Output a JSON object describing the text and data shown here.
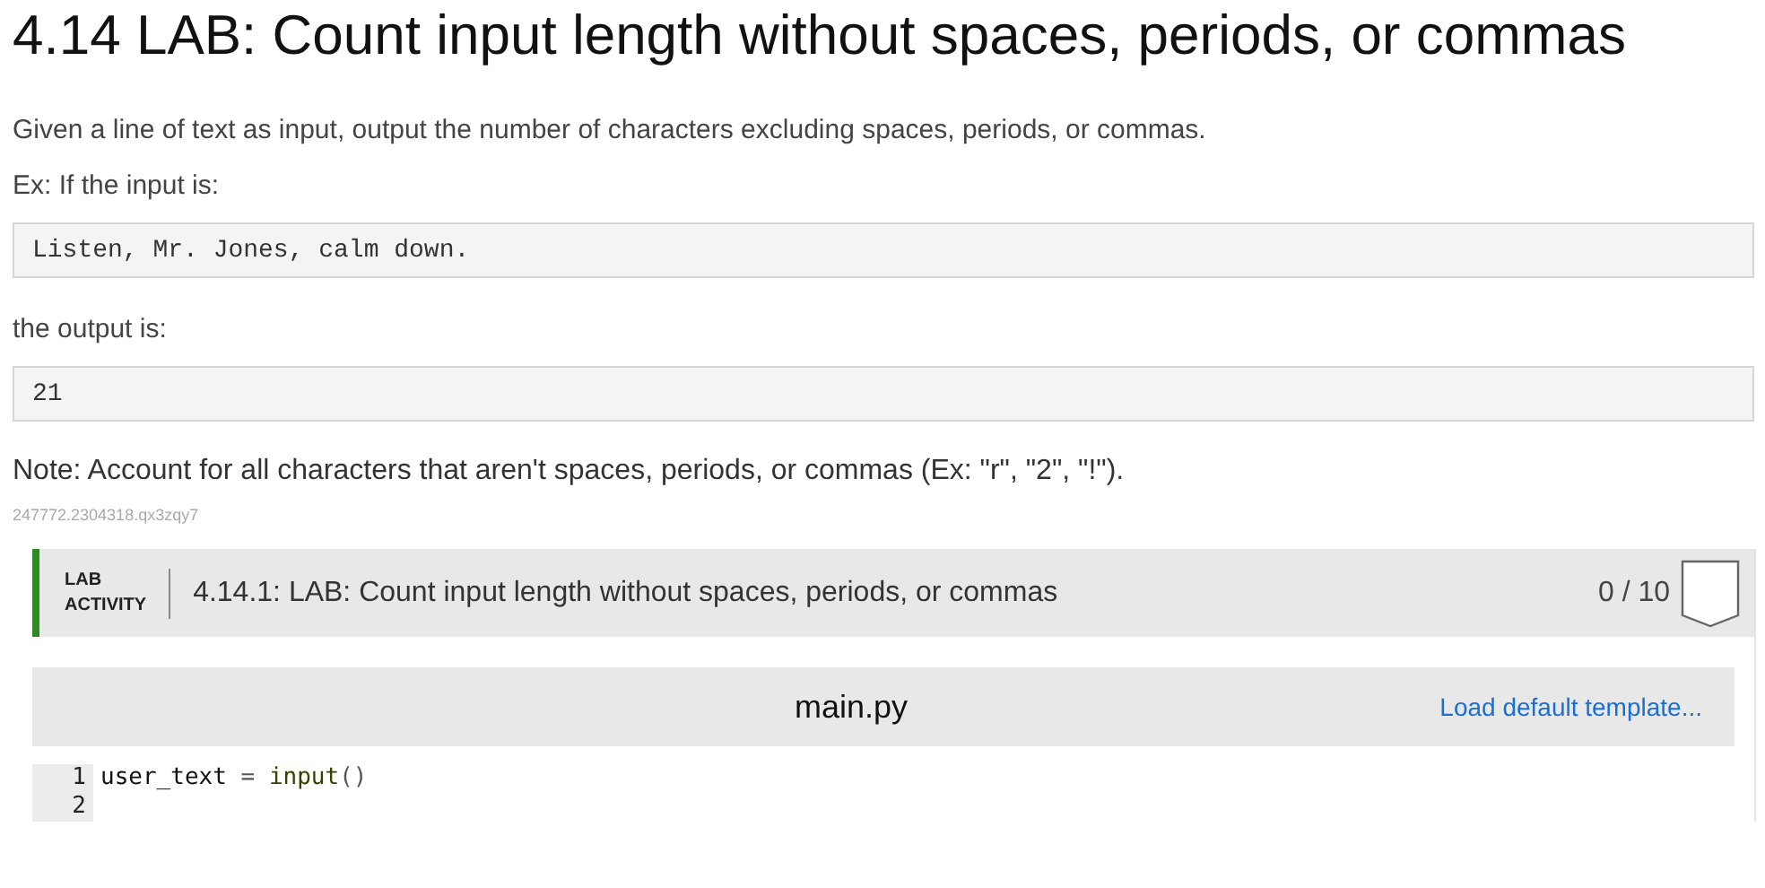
{
  "title": "4.14 LAB: Count input length without spaces, periods, or commas",
  "description": "Given a line of text as input, output the number of characters excluding spaces, periods, or commas.",
  "example_intro": "Ex: If the input is:",
  "example_input": "Listen, Mr. Jones, calm down.",
  "output_intro": "the output is:",
  "example_output": "21",
  "note": "Note: Account for all characters that aren't spaces, periods, or commas (Ex: \"r\", \"2\", \"!\").",
  "content_id": "247772.2304318.qx3zqy7",
  "lab": {
    "tag_line_1": "LAB",
    "tag_line_2": "ACTIVITY",
    "title": "4.14.1: LAB: Count input length without spaces, periods, or commas",
    "score": "0 / 10"
  },
  "editor": {
    "filename": "main.py",
    "template_link": "Load default template...",
    "lines": [
      {
        "number": "1",
        "tokens": [
          {
            "kind": "name",
            "text": "user_text"
          },
          {
            "kind": "op",
            "text": " = "
          },
          {
            "kind": "builtin",
            "text": "input"
          },
          {
            "kind": "op",
            "text": "()"
          }
        ]
      },
      {
        "number": "2"
      }
    ]
  }
}
